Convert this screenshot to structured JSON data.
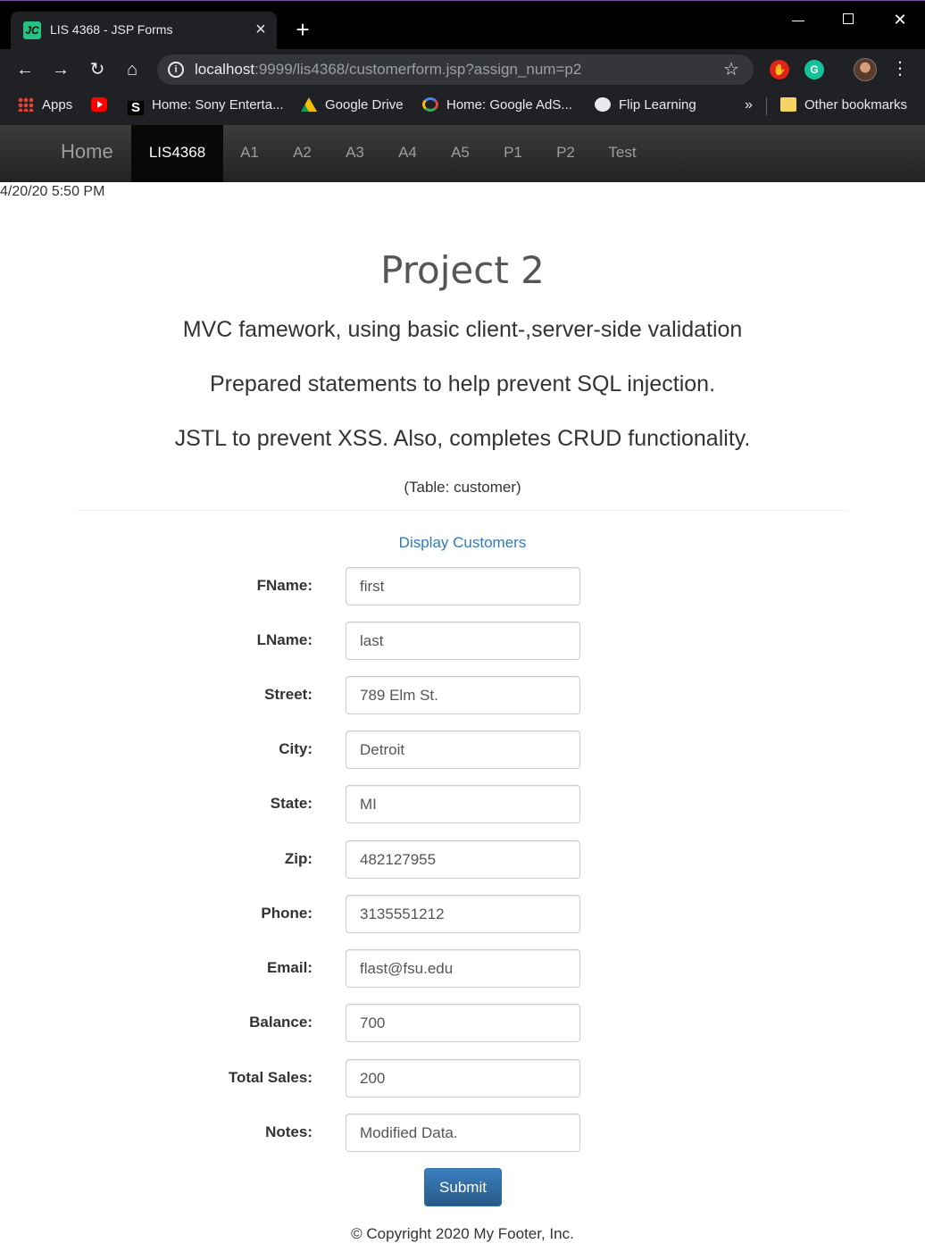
{
  "browser": {
    "tab_title": "LIS 4368 - JSP Forms",
    "tab_favicon_text": "JC",
    "url_host": "localhost",
    "url_rest": ":9999/lis4368/customerform.jsp?assign_num=p2",
    "bookmarks": [
      {
        "label": "Apps",
        "icon": "apps-icon"
      },
      {
        "label": "",
        "icon": "youtube-icon"
      },
      {
        "label": "Home: Sony Enterta...",
        "icon": "sony-icon"
      },
      {
        "label": "Google Drive",
        "icon": "google-drive-icon"
      },
      {
        "label": "Home: Google AdS...",
        "icon": "google-icon"
      },
      {
        "label": "Flip Learning",
        "icon": "globe-icon"
      }
    ],
    "bookmarks_more": "»",
    "other_bookmarks": "Other bookmarks"
  },
  "navbar": {
    "brand": "Home",
    "items": [
      "LIS4368",
      "A1",
      "A2",
      "A3",
      "A4",
      "A5",
      "P1",
      "P2",
      "Test"
    ],
    "active": "LIS4368"
  },
  "page": {
    "timestamp": "4/20/20 5:50 PM",
    "title": "Project 2",
    "lines": [
      "MVC famework, using basic client-,server-side validation",
      "Prepared statements to help prevent SQL injection.",
      "JSTL to prevent XSS. Also, completes CRUD functionality."
    ],
    "table_note": "(Table: customer)",
    "display_link": "Display Customers"
  },
  "form": {
    "fields": [
      {
        "label": "FName:",
        "value": "first"
      },
      {
        "label": "LName:",
        "value": "last"
      },
      {
        "label": "Street:",
        "value": "789 Elm St."
      },
      {
        "label": "City:",
        "value": "Detroit"
      },
      {
        "label": "State:",
        "value": "MI"
      },
      {
        "label": "Zip:",
        "value": "482127955"
      },
      {
        "label": "Phone:",
        "value": "3135551212"
      },
      {
        "label": "Email:",
        "value": "flast@fsu.edu"
      },
      {
        "label": "Balance:",
        "value": "700"
      },
      {
        "label": "Total Sales:",
        "value": "200"
      },
      {
        "label": "Notes:",
        "value": "Modified Data."
      }
    ],
    "submit_label": "Submit"
  },
  "footer": "© Copyright 2020 My Footer, Inc."
}
